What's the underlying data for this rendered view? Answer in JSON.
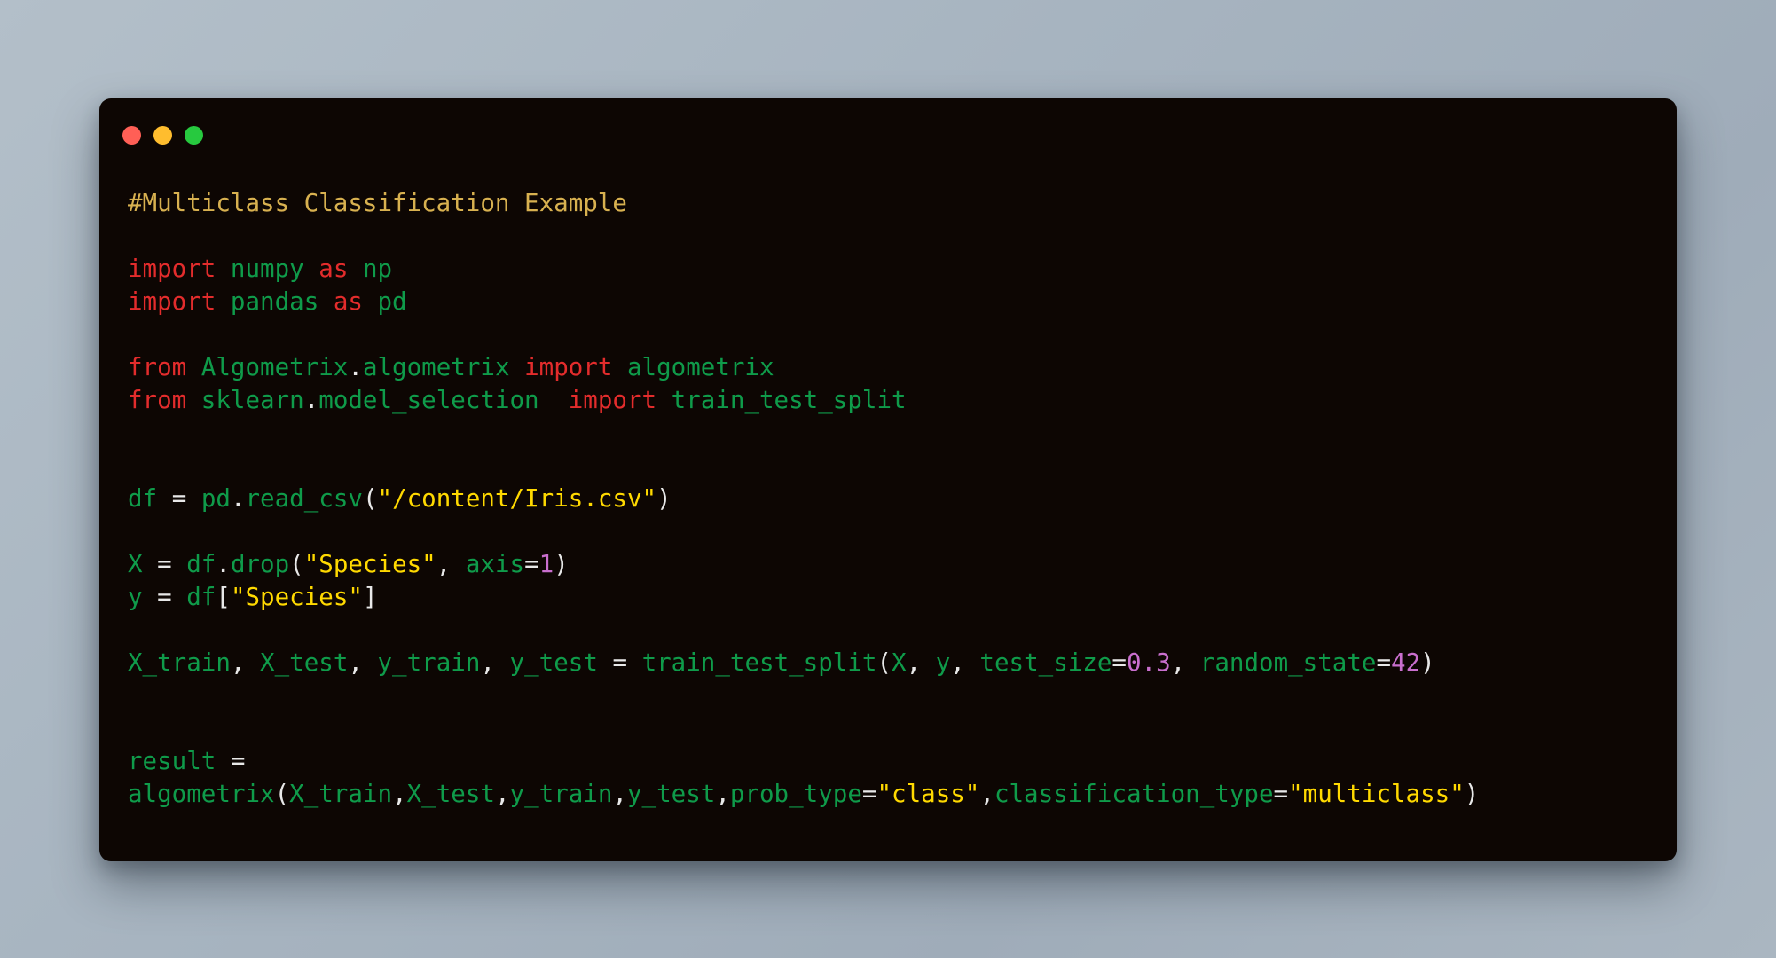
{
  "window": {
    "background_color": "#0d0603",
    "page_background_color": "#aab6c1",
    "traffic_lights": [
      {
        "name": "close",
        "color": "#ff5f56"
      },
      {
        "name": "minimize",
        "color": "#ffbd2e"
      },
      {
        "name": "maximize",
        "color": "#27c93f"
      }
    ]
  },
  "syntax_colors": {
    "comment": "#d8b150",
    "keyword": "#e32c2c",
    "name": "#0f9b4a",
    "string": "#ffd900",
    "number": "#c96fce",
    "punctuation": "#e8e8e8"
  },
  "code": {
    "language": "python",
    "lines": [
      {
        "index": 1,
        "text": "#Multiclass Classification Example",
        "tokens": [
          {
            "t": "#Multiclass Classification Example",
            "c": "comment"
          }
        ]
      },
      {
        "index": 2,
        "text": "",
        "tokens": []
      },
      {
        "index": 3,
        "text": "import numpy as np",
        "tokens": [
          {
            "t": "import",
            "c": "keyword"
          },
          {
            "t": " ",
            "c": "punct"
          },
          {
            "t": "numpy",
            "c": "name"
          },
          {
            "t": " ",
            "c": "punct"
          },
          {
            "t": "as",
            "c": "keyword"
          },
          {
            "t": " ",
            "c": "punct"
          },
          {
            "t": "np",
            "c": "name"
          }
        ]
      },
      {
        "index": 4,
        "text": "import pandas as pd",
        "tokens": [
          {
            "t": "import",
            "c": "keyword"
          },
          {
            "t": " ",
            "c": "punct"
          },
          {
            "t": "pandas",
            "c": "name"
          },
          {
            "t": " ",
            "c": "punct"
          },
          {
            "t": "as",
            "c": "keyword"
          },
          {
            "t": " ",
            "c": "punct"
          },
          {
            "t": "pd",
            "c": "name"
          }
        ]
      },
      {
        "index": 5,
        "text": "",
        "tokens": []
      },
      {
        "index": 6,
        "text": "from Algometrix.algometrix import algometrix",
        "tokens": [
          {
            "t": "from",
            "c": "keyword"
          },
          {
            "t": " ",
            "c": "punct"
          },
          {
            "t": "Algometrix",
            "c": "name"
          },
          {
            "t": ".",
            "c": "punct"
          },
          {
            "t": "algometrix",
            "c": "name"
          },
          {
            "t": " ",
            "c": "punct"
          },
          {
            "t": "import",
            "c": "keyword"
          },
          {
            "t": " ",
            "c": "punct"
          },
          {
            "t": "algometrix",
            "c": "name"
          }
        ]
      },
      {
        "index": 7,
        "text": "from sklearn.model_selection  import train_test_split",
        "tokens": [
          {
            "t": "from",
            "c": "keyword"
          },
          {
            "t": " ",
            "c": "punct"
          },
          {
            "t": "sklearn",
            "c": "name"
          },
          {
            "t": ".",
            "c": "punct"
          },
          {
            "t": "model_selection",
            "c": "name"
          },
          {
            "t": "  ",
            "c": "punct"
          },
          {
            "t": "import",
            "c": "keyword"
          },
          {
            "t": " ",
            "c": "punct"
          },
          {
            "t": "train_test_split",
            "c": "name"
          }
        ]
      },
      {
        "index": 8,
        "text": "",
        "tokens": []
      },
      {
        "index": 9,
        "text": "",
        "tokens": []
      },
      {
        "index": 10,
        "text": "df = pd.read_csv(\"/content/Iris.csv\")",
        "tokens": [
          {
            "t": "df",
            "c": "name"
          },
          {
            "t": " ",
            "c": "punct"
          },
          {
            "t": "=",
            "c": "punct"
          },
          {
            "t": " ",
            "c": "punct"
          },
          {
            "t": "pd",
            "c": "name"
          },
          {
            "t": ".",
            "c": "punct"
          },
          {
            "t": "read_csv",
            "c": "name"
          },
          {
            "t": "(",
            "c": "punct"
          },
          {
            "t": "\"/content/Iris.csv\"",
            "c": "string"
          },
          {
            "t": ")",
            "c": "punct"
          }
        ]
      },
      {
        "index": 11,
        "text": "",
        "tokens": []
      },
      {
        "index": 12,
        "text": "X = df.drop(\"Species\", axis=1)",
        "tokens": [
          {
            "t": "X",
            "c": "name"
          },
          {
            "t": " ",
            "c": "punct"
          },
          {
            "t": "=",
            "c": "punct"
          },
          {
            "t": " ",
            "c": "punct"
          },
          {
            "t": "df",
            "c": "name"
          },
          {
            "t": ".",
            "c": "punct"
          },
          {
            "t": "drop",
            "c": "name"
          },
          {
            "t": "(",
            "c": "punct"
          },
          {
            "t": "\"Species\"",
            "c": "string"
          },
          {
            "t": ",",
            "c": "punct"
          },
          {
            "t": " ",
            "c": "punct"
          },
          {
            "t": "axis",
            "c": "name"
          },
          {
            "t": "=",
            "c": "punct"
          },
          {
            "t": "1",
            "c": "number"
          },
          {
            "t": ")",
            "c": "punct"
          }
        ]
      },
      {
        "index": 13,
        "text": "y = df[\"Species\"]",
        "tokens": [
          {
            "t": "y",
            "c": "name"
          },
          {
            "t": " ",
            "c": "punct"
          },
          {
            "t": "=",
            "c": "punct"
          },
          {
            "t": " ",
            "c": "punct"
          },
          {
            "t": "df",
            "c": "name"
          },
          {
            "t": "[",
            "c": "punct"
          },
          {
            "t": "\"Species\"",
            "c": "string"
          },
          {
            "t": "]",
            "c": "punct"
          }
        ]
      },
      {
        "index": 14,
        "text": "",
        "tokens": []
      },
      {
        "index": 15,
        "text": "X_train, X_test, y_train, y_test = train_test_split(X, y, test_size=0.3, random_state=42)",
        "tokens": [
          {
            "t": "X_train",
            "c": "name"
          },
          {
            "t": ",",
            "c": "punct"
          },
          {
            "t": " ",
            "c": "punct"
          },
          {
            "t": "X_test",
            "c": "name"
          },
          {
            "t": ",",
            "c": "punct"
          },
          {
            "t": " ",
            "c": "punct"
          },
          {
            "t": "y_train",
            "c": "name"
          },
          {
            "t": ",",
            "c": "punct"
          },
          {
            "t": " ",
            "c": "punct"
          },
          {
            "t": "y_test",
            "c": "name"
          },
          {
            "t": " ",
            "c": "punct"
          },
          {
            "t": "=",
            "c": "punct"
          },
          {
            "t": " ",
            "c": "punct"
          },
          {
            "t": "train_test_split",
            "c": "name"
          },
          {
            "t": "(",
            "c": "punct"
          },
          {
            "t": "X",
            "c": "name"
          },
          {
            "t": ",",
            "c": "punct"
          },
          {
            "t": " ",
            "c": "punct"
          },
          {
            "t": "y",
            "c": "name"
          },
          {
            "t": ",",
            "c": "punct"
          },
          {
            "t": " ",
            "c": "punct"
          },
          {
            "t": "test_size",
            "c": "name"
          },
          {
            "t": "=",
            "c": "punct"
          },
          {
            "t": "0.3",
            "c": "number"
          },
          {
            "t": ",",
            "c": "punct"
          },
          {
            "t": " ",
            "c": "punct"
          },
          {
            "t": "random_state",
            "c": "name"
          },
          {
            "t": "=",
            "c": "punct"
          },
          {
            "t": "42",
            "c": "number"
          },
          {
            "t": ")",
            "c": "punct"
          }
        ]
      },
      {
        "index": 16,
        "text": "",
        "tokens": []
      },
      {
        "index": 17,
        "text": "",
        "tokens": []
      },
      {
        "index": 18,
        "text": "result = ",
        "tokens": [
          {
            "t": "result",
            "c": "name"
          },
          {
            "t": " ",
            "c": "punct"
          },
          {
            "t": "=",
            "c": "punct"
          }
        ]
      },
      {
        "index": 19,
        "text": "algometrix(X_train,X_test,y_train,y_test,prob_type=\"class\",classification_type=\"multiclass\")",
        "tokens": [
          {
            "t": "algometrix",
            "c": "name"
          },
          {
            "t": "(",
            "c": "punct"
          },
          {
            "t": "X_train",
            "c": "name"
          },
          {
            "t": ",",
            "c": "punct"
          },
          {
            "t": "X_test",
            "c": "name"
          },
          {
            "t": ",",
            "c": "punct"
          },
          {
            "t": "y_train",
            "c": "name"
          },
          {
            "t": ",",
            "c": "punct"
          },
          {
            "t": "y_test",
            "c": "name"
          },
          {
            "t": ",",
            "c": "punct"
          },
          {
            "t": "prob_type",
            "c": "name"
          },
          {
            "t": "=",
            "c": "punct"
          },
          {
            "t": "\"class\"",
            "c": "string"
          },
          {
            "t": ",",
            "c": "punct"
          },
          {
            "t": "classification_type",
            "c": "name"
          },
          {
            "t": "=",
            "c": "punct"
          },
          {
            "t": "\"multiclass\"",
            "c": "string"
          },
          {
            "t": ")",
            "c": "punct"
          }
        ]
      }
    ]
  }
}
